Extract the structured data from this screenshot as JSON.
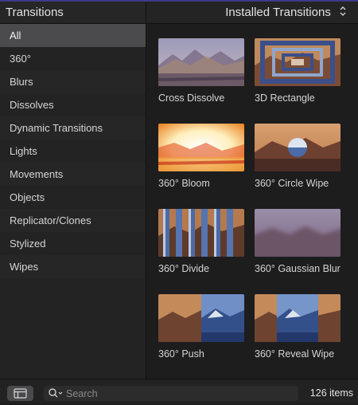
{
  "sidebar": {
    "title": "Transitions",
    "items": [
      "All",
      "360°",
      "Blurs",
      "Dissolves",
      "Dynamic Transitions",
      "Lights",
      "Movements",
      "Objects",
      "Replicator/Clones",
      "Stylized",
      "Wipes"
    ],
    "selected": "All"
  },
  "main": {
    "title": "Installed Transitions",
    "tiles": [
      {
        "label": "Cross Dissolve",
        "icon": "cross-dissolve-thumbnail"
      },
      {
        "label": "3D Rectangle",
        "icon": "3d-rectangle-thumbnail"
      },
      {
        "label": "360° Bloom",
        "icon": "360-bloom-thumbnail"
      },
      {
        "label": "360° Circle Wipe",
        "icon": "360-circle-wipe-thumbnail"
      },
      {
        "label": "360° Divide",
        "icon": "360-divide-thumbnail"
      },
      {
        "label": "360° Gaussian Blur",
        "icon": "360-gaussian-blur-thumbnail"
      },
      {
        "label": "360° Push",
        "icon": "360-push-thumbnail"
      },
      {
        "label": "360° Reveal Wipe",
        "icon": "360-reveal-wipe-thumbnail"
      }
    ]
  },
  "bottom": {
    "search_placeholder": "Search",
    "item_count": "126 items"
  },
  "colors": {
    "accent": "#3d3a8c",
    "selected_row": "#4b4b4d",
    "background": "#1e1e1e"
  }
}
